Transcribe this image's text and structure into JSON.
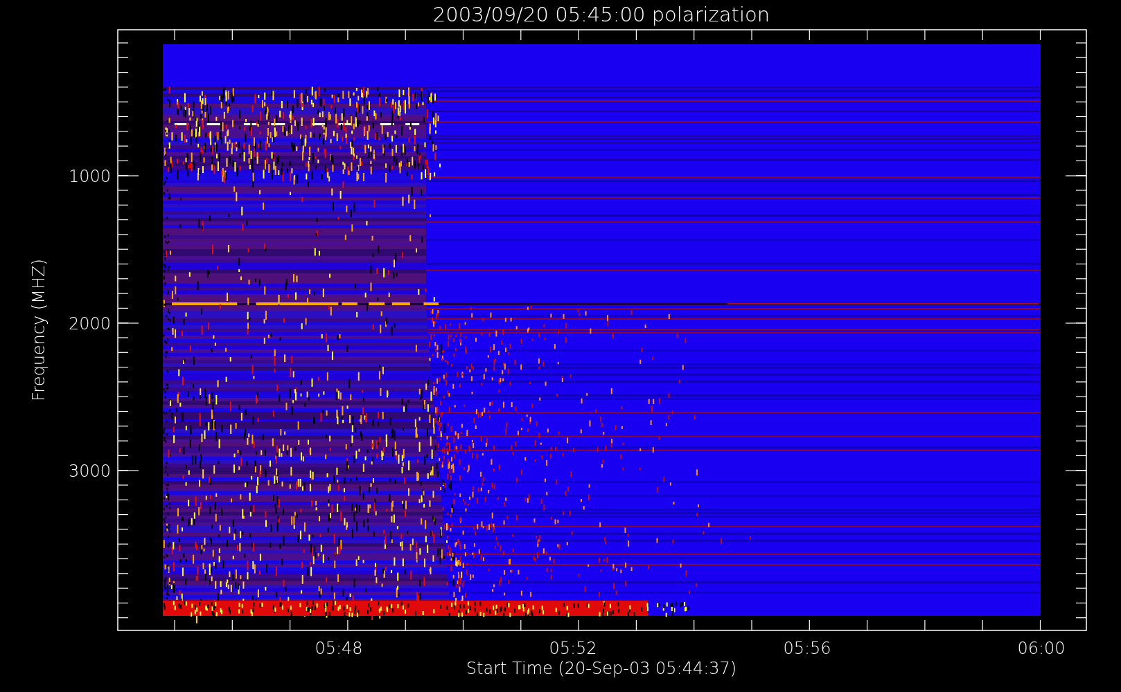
{
  "title": "2003/09/20 05:45:00 polarization",
  "y_axis": {
    "label": "Frequency (MHZ)",
    "ticks": [
      "1000",
      "2000",
      "3000"
    ]
  },
  "x_axis": {
    "label": "Start Time (20-Sep-03 05:44:37)",
    "ticks": [
      "05:48",
      "05:52",
      "05:56",
      "06:00"
    ]
  }
}
